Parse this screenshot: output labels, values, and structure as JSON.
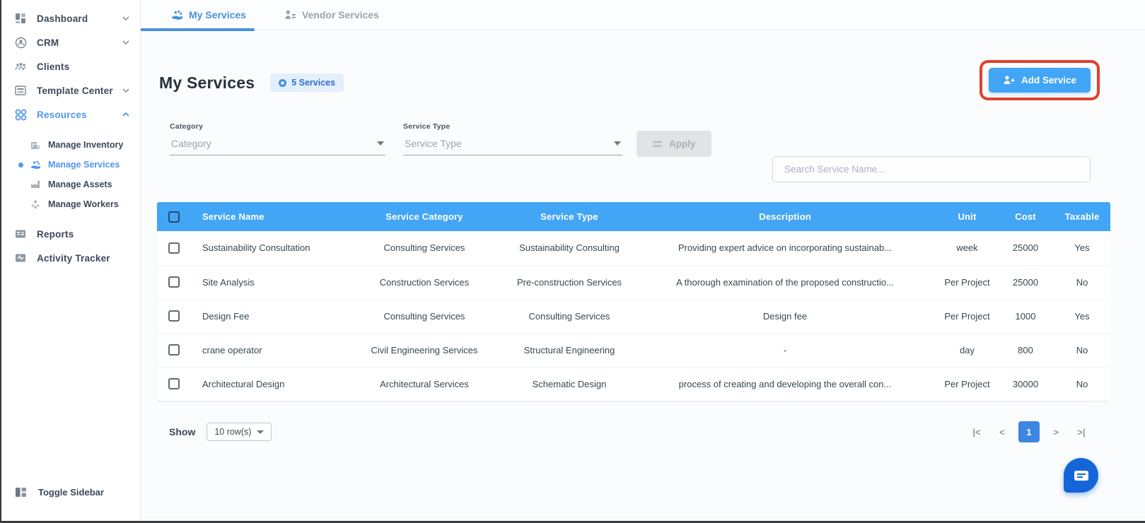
{
  "sidebar": {
    "items": [
      {
        "label": "Dashboard",
        "icon": "dashboard-icon",
        "chevron": "down"
      },
      {
        "label": "CRM",
        "icon": "crm-icon",
        "chevron": "down"
      },
      {
        "label": "Clients",
        "icon": "clients-icon",
        "chevron": ""
      },
      {
        "label": "Template Center",
        "icon": "template-center-icon",
        "chevron": "down"
      },
      {
        "label": "Resources",
        "icon": "resources-icon",
        "chevron": "up"
      }
    ],
    "resources_children": [
      {
        "label": "Manage Inventory"
      },
      {
        "label": "Manage Services"
      },
      {
        "label": "Manage Assets"
      },
      {
        "label": "Manage Workers"
      }
    ],
    "reports_label": "Reports",
    "activity_label": "Activity Tracker",
    "toggle_label": "Toggle Sidebar"
  },
  "tabs": {
    "my_services": "My Services",
    "vendor_services": "Vendor Services"
  },
  "header": {
    "title": "My Services",
    "badge": "5 Services",
    "add_button": "Add Service"
  },
  "filters": {
    "category_label": "Category",
    "category_placeholder": "Category",
    "service_type_label": "Service Type",
    "service_type_placeholder": "Service Type",
    "apply_label": "Apply",
    "search_placeholder": "Search Service Name..."
  },
  "table": {
    "columns": [
      "Service Name",
      "Service Category",
      "Service Type",
      "Description",
      "Unit",
      "Cost",
      "Taxable"
    ],
    "rows": [
      [
        "Sustainability Consultation",
        "Consulting Services",
        "Sustainability Consulting",
        "Providing expert advice on incorporating sustainab...",
        "week",
        "25000",
        "Yes"
      ],
      [
        "Site Analysis",
        "Construction Services",
        "Pre-construction Services",
        "A thorough examination of the proposed constructio...",
        "Per Project",
        "25000",
        "No"
      ],
      [
        "Design Fee",
        "Consulting Services",
        "Consulting Services",
        "Design fee",
        "Per Project",
        "1000",
        "Yes"
      ],
      [
        "crane operator",
        "Civil Engineering Services",
        "Structural Engineering",
        "-",
        "day",
        "800",
        "No"
      ],
      [
        "Architectural Design",
        "Architectural Services",
        "Schematic Design",
        "process of creating and developing the overall con...",
        "Per Project",
        "30000",
        "No"
      ]
    ]
  },
  "footer": {
    "show_label": "Show",
    "rows_selector": "10 row(s)",
    "page": "1",
    "first": "|<",
    "prev": "<",
    "next": ">",
    "last": ">|"
  },
  "colors": {
    "primary": "#42a5f5",
    "sidebar_active": "#4f97e8",
    "annotation": "#e3402a"
  }
}
